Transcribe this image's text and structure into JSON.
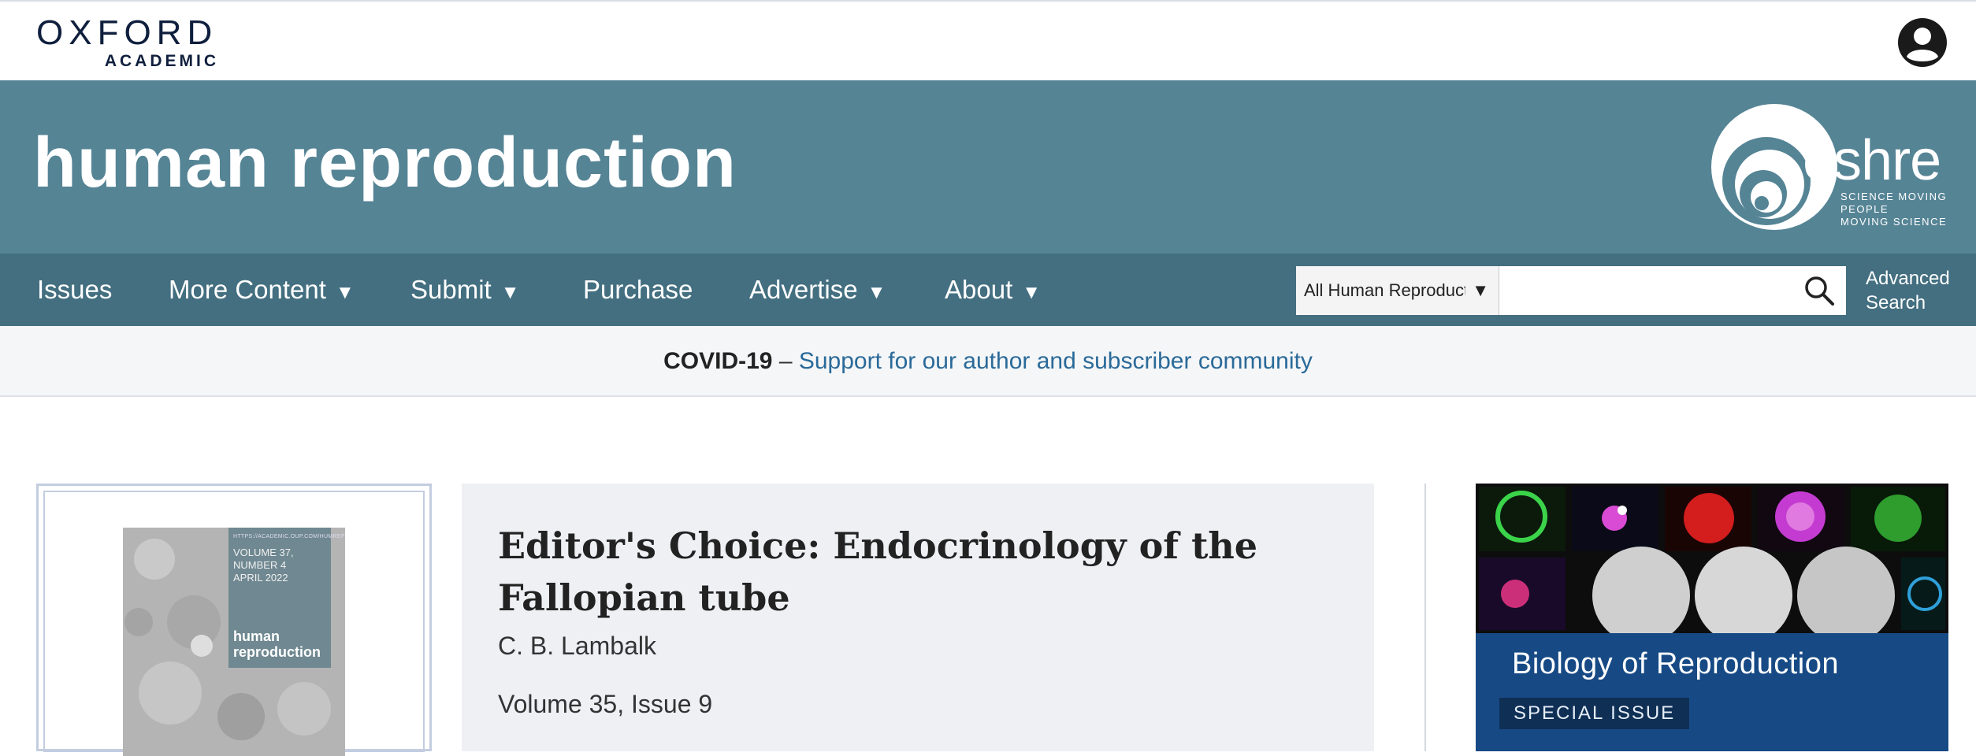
{
  "header": {
    "publisher_name": "OXFORD",
    "publisher_sub": "ACADEMIC",
    "account_icon": "user-circle-icon"
  },
  "banner": {
    "journal_title": "human reproduction",
    "society_logo_word": "eshre",
    "society_tagline": [
      "SCIENCE MOVING",
      "PEOPLE",
      "MOVING SCIENCE"
    ]
  },
  "nav": {
    "items": [
      {
        "label": "Issues",
        "has_dropdown": false
      },
      {
        "label": "More Content",
        "has_dropdown": true
      },
      {
        "label": "Submit",
        "has_dropdown": true
      },
      {
        "label": "Purchase",
        "has_dropdown": false
      },
      {
        "label": "Advertise",
        "has_dropdown": true
      },
      {
        "label": "About",
        "has_dropdown": true
      }
    ],
    "dropdown_caret": "▼",
    "search": {
      "scope_value": "All Human Reproduction",
      "placeholder": "",
      "icon": "search-icon"
    },
    "advanced_search_line1": "Advanced",
    "advanced_search_line2": "Search"
  },
  "covid": {
    "bold": "COVID-19",
    "separator": " – ",
    "link": "Support for our author and subscriber community"
  },
  "cover": {
    "url": "HTTPS://ACADEMIC.OUP.COM/HUMREP",
    "volume_line1": "VOLUME 37, NUMBER 4",
    "volume_line2": "APRIL 2022",
    "title_line1": "human",
    "title_line2": "reproduction"
  },
  "editors_choice": {
    "title": "Editor's Choice: Endocrinology of the Fallopian tube",
    "author": "C. B. Lambalk",
    "volume": "Volume 35, Issue 9"
  },
  "promo": {
    "title": "Biology of Reproduction",
    "badge": "SPECIAL ISSUE"
  },
  "colors": {
    "banner": "#558495",
    "nav": "#436f80",
    "link": "#2a6a99",
    "promo": "#174a85"
  }
}
